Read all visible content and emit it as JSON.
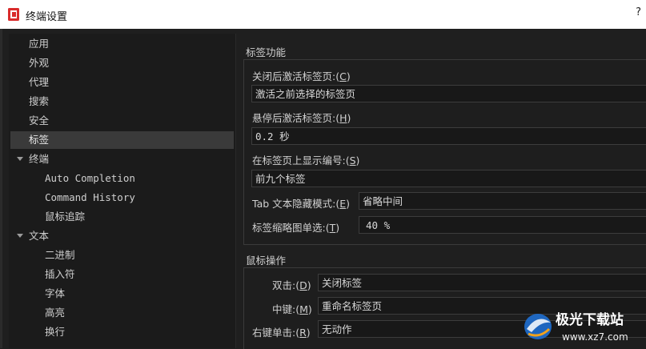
{
  "window": {
    "title": "终端设置",
    "help_label": "?"
  },
  "sidebar": {
    "items": [
      {
        "label": "应用"
      },
      {
        "label": "外观"
      },
      {
        "label": "代理"
      },
      {
        "label": "搜索"
      },
      {
        "label": "安全"
      },
      {
        "label": "标签",
        "selected": true
      },
      {
        "label": "终端",
        "expanded": true
      },
      {
        "label": "Auto Completion"
      },
      {
        "label": "Command History"
      },
      {
        "label": "鼠标追踪"
      },
      {
        "label": "文本",
        "expanded": true
      },
      {
        "label": "二进制"
      },
      {
        "label": "插入符"
      },
      {
        "label": "字体"
      },
      {
        "label": "高亮"
      },
      {
        "label": "换行"
      }
    ]
  },
  "tabs_section": {
    "title": "标签功能",
    "activate_after_close": {
      "label": "关闭后激活标签页:(",
      "key": "C",
      "suffix": ")",
      "value": "激活之前选择的标签页"
    },
    "hover_activate": {
      "label": "悬停后激活标签页:(",
      "key": "H",
      "suffix": ")",
      "value": "0.2 秒"
    },
    "show_number": {
      "label": "在标签页上显示编号:(",
      "key": "S",
      "suffix": ")",
      "value": "前九个标签"
    },
    "text_hide_mode": {
      "label": "Tab 文本隐藏模式:(",
      "key": "E",
      "suffix": ")",
      "value": "省略中间"
    },
    "thumbnail_select": {
      "label": "标签缩略图单选:(",
      "key": "T",
      "suffix": ")",
      "value": "40 %"
    }
  },
  "mouse_section": {
    "title": "鼠标操作",
    "double_click": {
      "label": "双击:(",
      "key": "D",
      "suffix": ")",
      "value": "关闭标签"
    },
    "middle_click": {
      "label": "中键:(",
      "key": "M",
      "suffix": ")",
      "value": "重命名标签页"
    },
    "right_click": {
      "label": "右键单击:(",
      "key": "R",
      "suffix": ")",
      "value": "无动作"
    }
  },
  "watermark": {
    "text": "极光下载站",
    "url": "www.xz7.com"
  }
}
